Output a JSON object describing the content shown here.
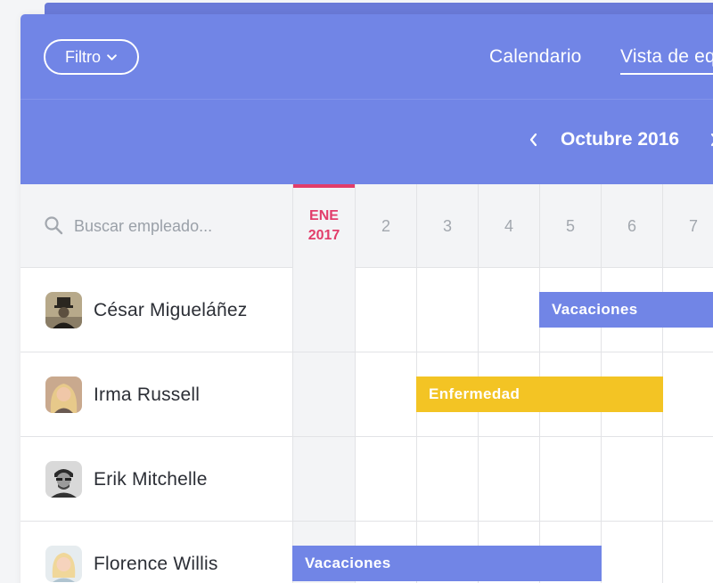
{
  "header": {
    "filter_label": "Filtro",
    "tabs": [
      {
        "label": "Calendario"
      },
      {
        "label": "Vista de eq"
      }
    ]
  },
  "month": {
    "label": "Octubre 2016"
  },
  "search": {
    "placeholder": "Buscar empleado..."
  },
  "days": [
    {
      "top": "ENE",
      "bottom": "2017",
      "current": true
    },
    {
      "label": "2"
    },
    {
      "label": "3"
    },
    {
      "label": "4"
    },
    {
      "label": "5"
    },
    {
      "label": "6"
    },
    {
      "label": "7"
    }
  ],
  "employees": [
    {
      "name": "César Migueláñez",
      "avatar": "avatar-cesar"
    },
    {
      "name": "Irma Russell",
      "avatar": "avatar-irma"
    },
    {
      "name": "Erik Mitchelle",
      "avatar": "avatar-erik"
    },
    {
      "name": "Florence Willis",
      "avatar": "avatar-florence"
    }
  ],
  "events": [
    {
      "employee": "César Migueláñez",
      "label": "Vacaciones",
      "type": "vacation",
      "color": "#7185e6"
    },
    {
      "employee": "Irma Russell",
      "label": "Enfermedad",
      "type": "sick",
      "color": "#f3c424"
    },
    {
      "employee": "Florence Willis",
      "label": "Vacaciones",
      "type": "vacation",
      "color": "#7185e6"
    }
  ],
  "colors": {
    "primary": "#7185e6",
    "accent": "#e23d6a",
    "sick": "#f3c424"
  }
}
